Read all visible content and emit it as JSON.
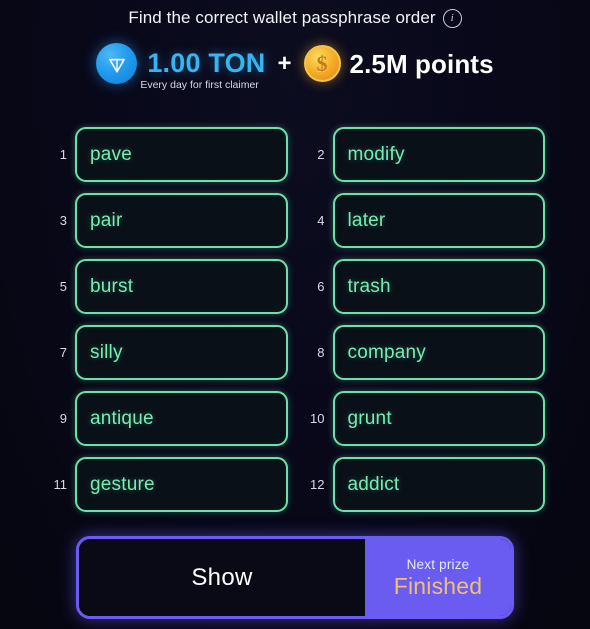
{
  "header": {
    "title": "Find the correct wallet passphrase order",
    "info_icon": "info-circle-icon"
  },
  "prize": {
    "ton_icon": "ton-logo-icon",
    "ton_amount": "1.00 TON",
    "ton_subtitle": "Every day for first claimer",
    "plus": "+",
    "coin_icon": "points-coin-icon",
    "coin_symbol": "$",
    "points_amount": "2.5M points"
  },
  "words": [
    {
      "index": "1",
      "word": "pave"
    },
    {
      "index": "2",
      "word": "modify"
    },
    {
      "index": "3",
      "word": "pair"
    },
    {
      "index": "4",
      "word": "later"
    },
    {
      "index": "5",
      "word": "burst"
    },
    {
      "index": "6",
      "word": "trash"
    },
    {
      "index": "7",
      "word": "silly"
    },
    {
      "index": "8",
      "word": "company"
    },
    {
      "index": "9",
      "word": "antique"
    },
    {
      "index": "10",
      "word": "grunt"
    },
    {
      "index": "11",
      "word": "gesture"
    },
    {
      "index": "12",
      "word": "addict"
    }
  ],
  "bottom": {
    "show_label": "Show",
    "next_prize_label": "Next prize",
    "next_prize_status": "Finished"
  },
  "colors": {
    "background": "#08081a",
    "word_border": "#6fe0a8",
    "word_text": "#79ecb2",
    "ton_blue": "#36b5f0",
    "coin_gold": "#f4ab27",
    "accent_purple": "#6a5cf0",
    "status_orange": "#f0c070"
  }
}
